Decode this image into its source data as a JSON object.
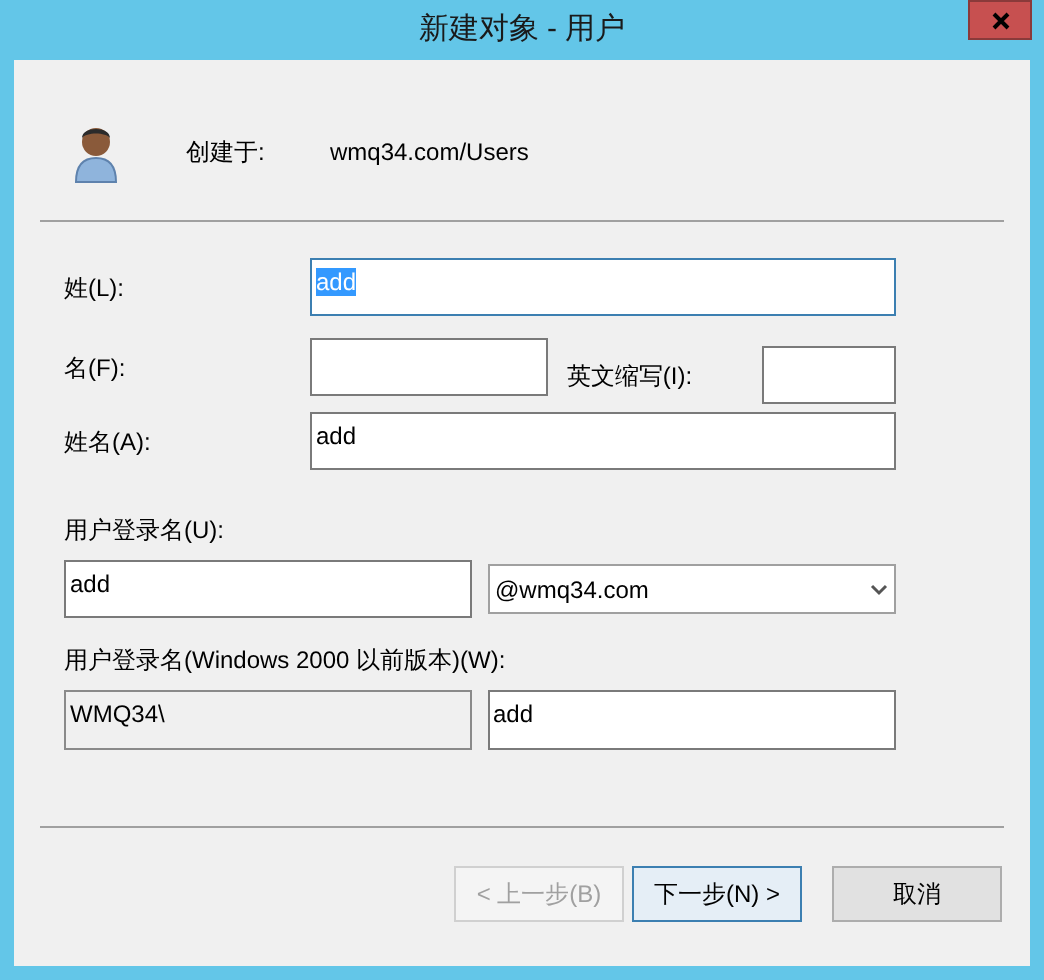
{
  "window": {
    "title": "新建对象 - 用户"
  },
  "created_in": {
    "label": "创建于:",
    "value": "wmq34.com/Users"
  },
  "last_name": {
    "label": "姓(L):",
    "value": "add",
    "text_selected": true
  },
  "first_name": {
    "label": "名(F):"
  },
  "initials": {
    "label": "英文缩写(I):"
  },
  "full_name": {
    "label": "姓名(A):",
    "value": "add"
  },
  "logon": {
    "label": "用户登录名(U):",
    "value": "add",
    "domain": "@wmq34.com"
  },
  "logon_pre2000": {
    "label": "用户登录名(Windows 2000 以前版本)(W):",
    "domain": {
      "value": "WMQ34\\",
      "disabled": true
    },
    "value": "add"
  },
  "buttons": [
    {
      "label": "< 上一步(B)",
      "disabled": true,
      "default": false
    },
    {
      "label": "下一步(N) >",
      "disabled": false,
      "default": true
    },
    {
      "label": "取消",
      "disabled": false,
      "default": false
    }
  ]
}
